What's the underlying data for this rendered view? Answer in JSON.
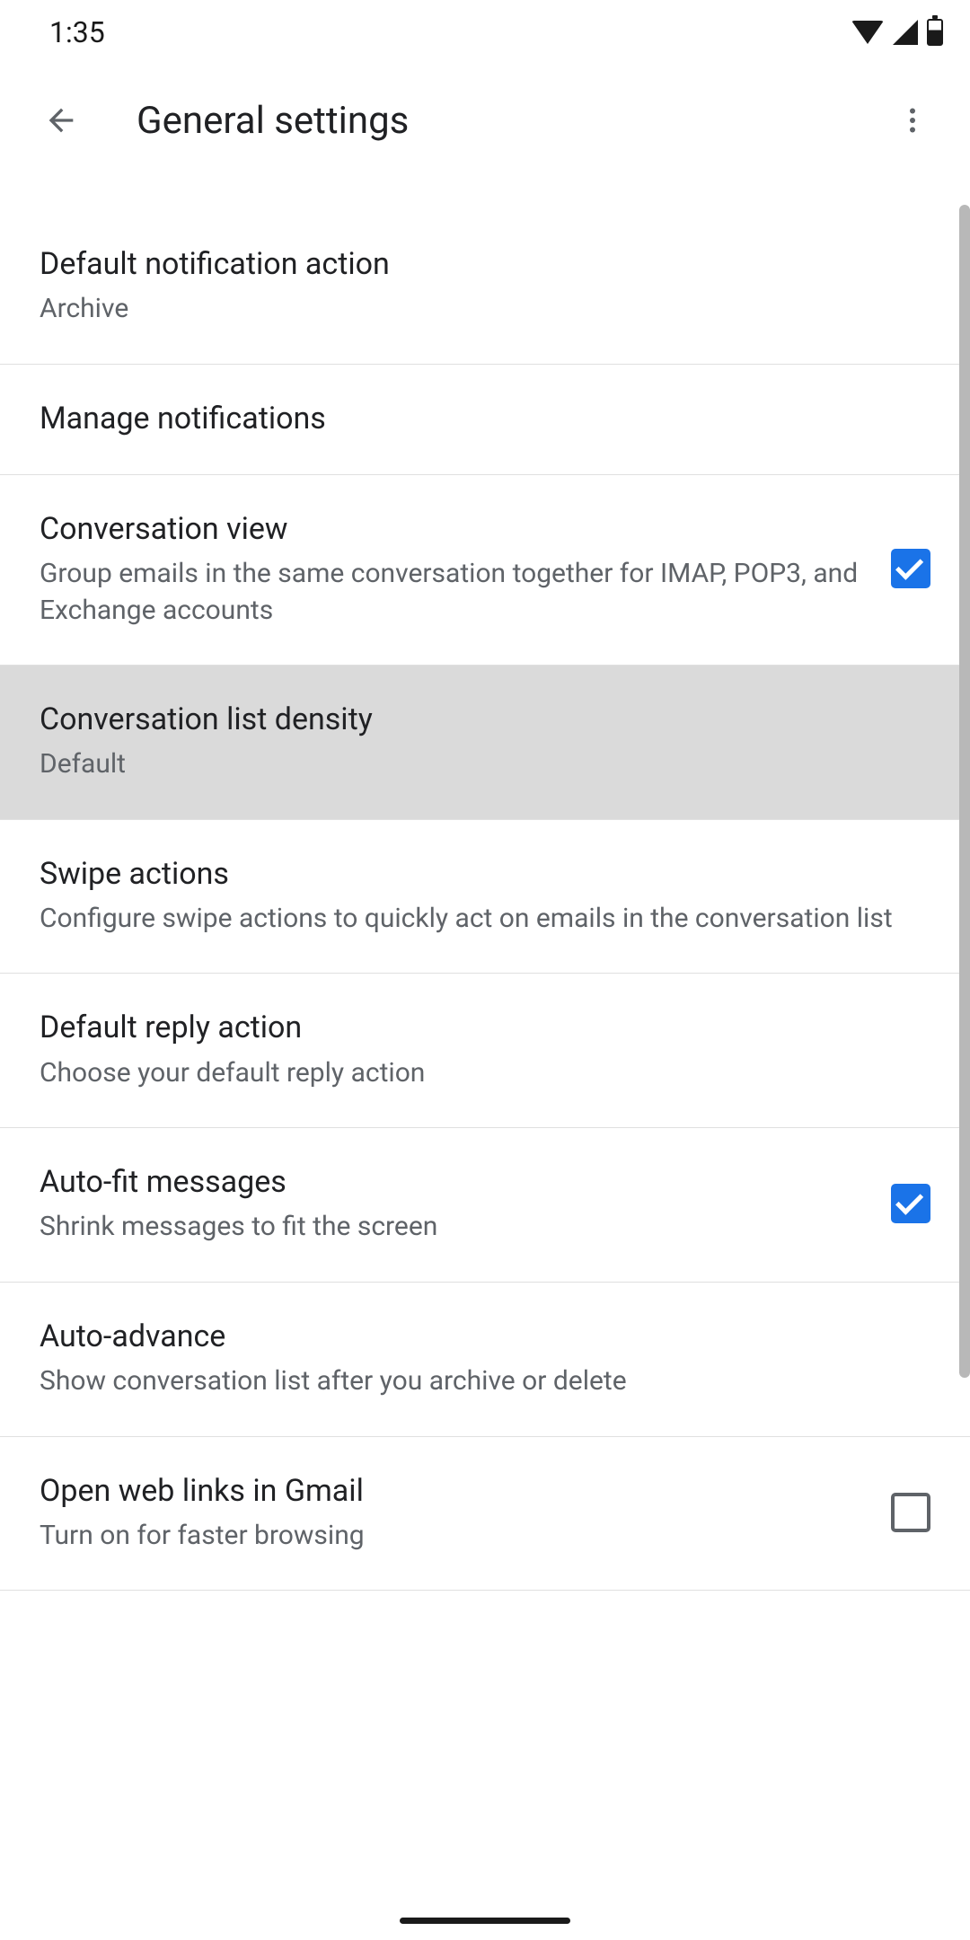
{
  "status_bar": {
    "time": "1:35"
  },
  "header": {
    "title": "General settings"
  },
  "settings": [
    {
      "title": "Default notification action",
      "subtitle": "Archive",
      "checkbox": null,
      "highlighted": false
    },
    {
      "title": "Manage notifications",
      "subtitle": null,
      "checkbox": null,
      "highlighted": false
    },
    {
      "title": "Conversation view",
      "subtitle": "Group emails in the same conversation together for IMAP, POP3, and Exchange accounts",
      "checkbox": true,
      "highlighted": false
    },
    {
      "title": "Conversation list density",
      "subtitle": "Default",
      "checkbox": null,
      "highlighted": true
    },
    {
      "title": "Swipe actions",
      "subtitle": "Configure swipe actions to quickly act on emails in the conversation list",
      "checkbox": null,
      "highlighted": false
    },
    {
      "title": "Default reply action",
      "subtitle": "Choose your default reply action",
      "checkbox": null,
      "highlighted": false
    },
    {
      "title": "Auto-fit messages",
      "subtitle": "Shrink messages to fit the screen",
      "checkbox": true,
      "highlighted": false
    },
    {
      "title": "Auto-advance",
      "subtitle": "Show conversation list after you archive or delete",
      "checkbox": null,
      "highlighted": false
    },
    {
      "title": "Open web links in Gmail",
      "subtitle": "Turn on for faster browsing",
      "checkbox": false,
      "highlighted": false
    }
  ]
}
